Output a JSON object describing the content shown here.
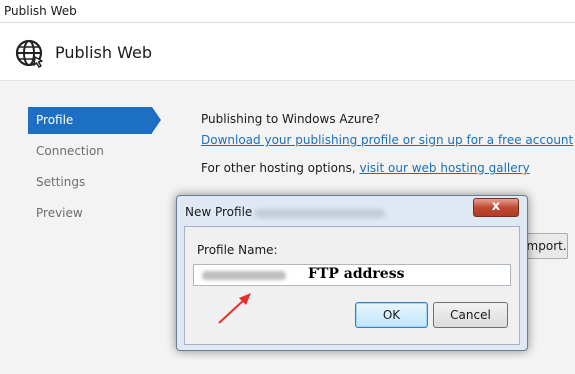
{
  "window": {
    "title": "Publish Web"
  },
  "header": {
    "icon": "globe-icon",
    "title": "Publish Web"
  },
  "nav": {
    "items": [
      {
        "label": "Profile",
        "active": true
      },
      {
        "label": "Connection",
        "active": false
      },
      {
        "label": "Settings",
        "active": false
      },
      {
        "label": "Preview",
        "active": false
      }
    ]
  },
  "content": {
    "azure_heading": "Publishing to Windows Azure?",
    "download_link": "Download your publishing profile or sign up for a free account",
    "other_hosting_text": "For other hosting options,",
    "gallery_link": "visit our web hosting gallery",
    "import_button_partial": "Import..."
  },
  "dialog": {
    "title": "New Profile",
    "close_label": "x",
    "profile_name_label": "Profile Name:",
    "annotation": "FTP address",
    "ok_label": "OK",
    "cancel_label": "Cancel"
  },
  "colors": {
    "accent": "#1c6fc2",
    "link": "#1d6fb8",
    "annotation_arrow": "#e8302a"
  }
}
